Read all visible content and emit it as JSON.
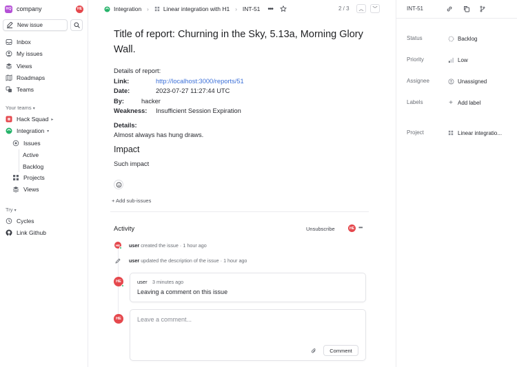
{
  "workspace": {
    "logo": "HQ",
    "name": "company",
    "user_initials": "HE"
  },
  "sidebar": {
    "new_issue": "New issue",
    "items": [
      {
        "label": "Inbox",
        "icon": "inbox-icon"
      },
      {
        "label": "My issues",
        "icon": "my-issues-icon"
      },
      {
        "label": "Views",
        "icon": "views-icon"
      },
      {
        "label": "Roadmaps",
        "icon": "roadmaps-icon"
      },
      {
        "label": "Teams",
        "icon": "teams-icon"
      }
    ],
    "your_teams_label": "Your teams",
    "teams": [
      {
        "label": "Hack Squad"
      },
      {
        "label": "Integration"
      }
    ],
    "integration_children": [
      {
        "label": "Issues"
      },
      {
        "label": "Active"
      },
      {
        "label": "Backlog"
      },
      {
        "label": "Projects"
      },
      {
        "label": "Views"
      }
    ],
    "try_label": "Try",
    "try_items": [
      {
        "label": "Cycles"
      },
      {
        "label": "Link Github"
      }
    ]
  },
  "header": {
    "team": "Integration",
    "project": "Linear integration with H1",
    "issue_id": "INT-51",
    "counter": "2 / 3"
  },
  "issue": {
    "title": "Title of report: Churning in the Sky, 5.13a, Morning Glory Wall.",
    "details_of_report": "Details of report:",
    "link_label": "Link:",
    "link_value": "http://localhost:3000/reports/51",
    "date_label": "Date:",
    "date_value": "2023-07-27 11:27:44 UTC",
    "by_label": "By:",
    "by_value": "hacker",
    "weakness_label": "Weakness:",
    "weakness_value": "Insufficient Session Expiration",
    "details_label": "Details:",
    "details_value": "Almost always has hung draws.",
    "impact_heading": "Impact",
    "impact_value": "Such impact",
    "add_sub_issues": "+ Add sub-issues"
  },
  "activity": {
    "title": "Activity",
    "unsubscribe": "Unsubscribe",
    "avatar": "HE",
    "events": [
      {
        "user": "user",
        "text": "created the issue",
        "time": "1 hour ago"
      },
      {
        "user": "user",
        "text": "updated the description of the issue",
        "time": "1 hour ago"
      }
    ],
    "comment": {
      "avatar": "HE",
      "user": "user",
      "time": "3 minutes ago",
      "text": "Leaving a comment on this issue"
    },
    "new_comment": {
      "avatar": "HE",
      "placeholder": "Leave a comment...",
      "button": "Comment"
    }
  },
  "properties": {
    "issue_id": "INT-51",
    "status_label": "Status",
    "status_value": "Backlog",
    "priority_label": "Priority",
    "priority_value": "Low",
    "assignee_label": "Assignee",
    "assignee_value": "Unassigned",
    "labels_label": "Labels",
    "labels_value": "Add label",
    "project_label": "Project",
    "project_value": "Linear integratio..."
  },
  "colors": {
    "accent_red": "#e5484d",
    "link": "#3b6fd8",
    "workspace": "#b44fd6",
    "team_green": "#26b36a"
  }
}
